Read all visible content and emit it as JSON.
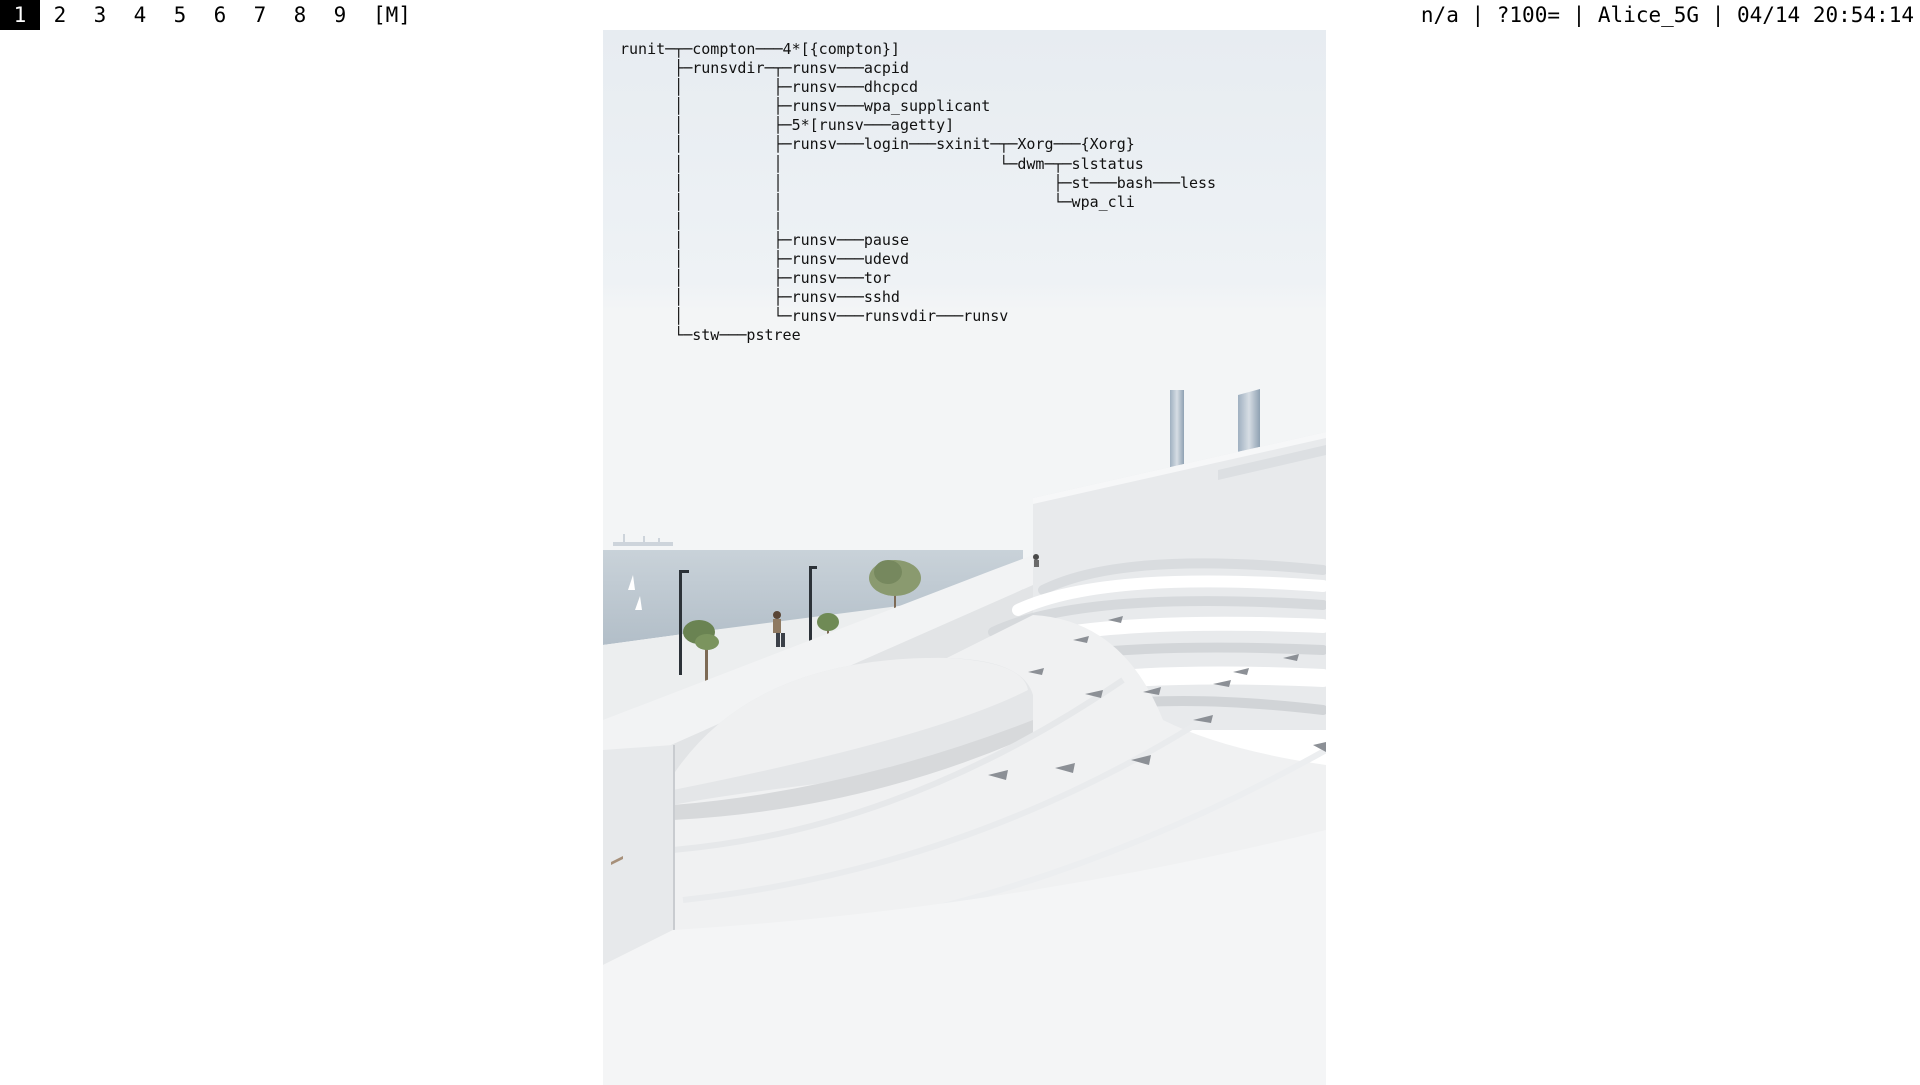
{
  "bar": {
    "tags": [
      "1",
      "2",
      "3",
      "4",
      "5",
      "6",
      "7",
      "8",
      "9"
    ],
    "selected_tag": "1",
    "layout_symbol": "[M]",
    "status_text": "n/a | ?100= | Alice_5G | 04/14 20:54:14"
  },
  "terminal": {
    "command_output_lines": [
      "runit─┬─compton───4*[{compton}]",
      "      ├─runsvdir─┬─runsv───acpid",
      "      │          ├─runsv───dhcpcd",
      "      │          ├─runsv───wpa_supplicant",
      "      │          ├─5*[runsv───agetty]",
      "      │          ├─runsv───login───sxinit─┬─Xorg───{Xorg}",
      "      │          │                        └─dwm─┬─slstatus",
      "      │          │                              ├─st───bash───less",
      "      │          │                              └─wpa_cli",
      "      │          │",
      "      │          ├─runsv───pause",
      "      │          ├─runsv───udevd",
      "      │          ├─runsv───tor",
      "      │          ├─runsv───sshd",
      "      │          └─runsv───runsvdir───runsv",
      "      └─stw───pstree"
    ]
  },
  "colors": {
    "bar_bg": "#ffffff",
    "bar_fg": "#000000",
    "selected_tag_bg": "#000000",
    "selected_tag_fg": "#ffffff",
    "terminal_text": "#111111"
  },
  "wallpaper": {
    "icon": "amphitheater-seaside-photo-icon"
  }
}
